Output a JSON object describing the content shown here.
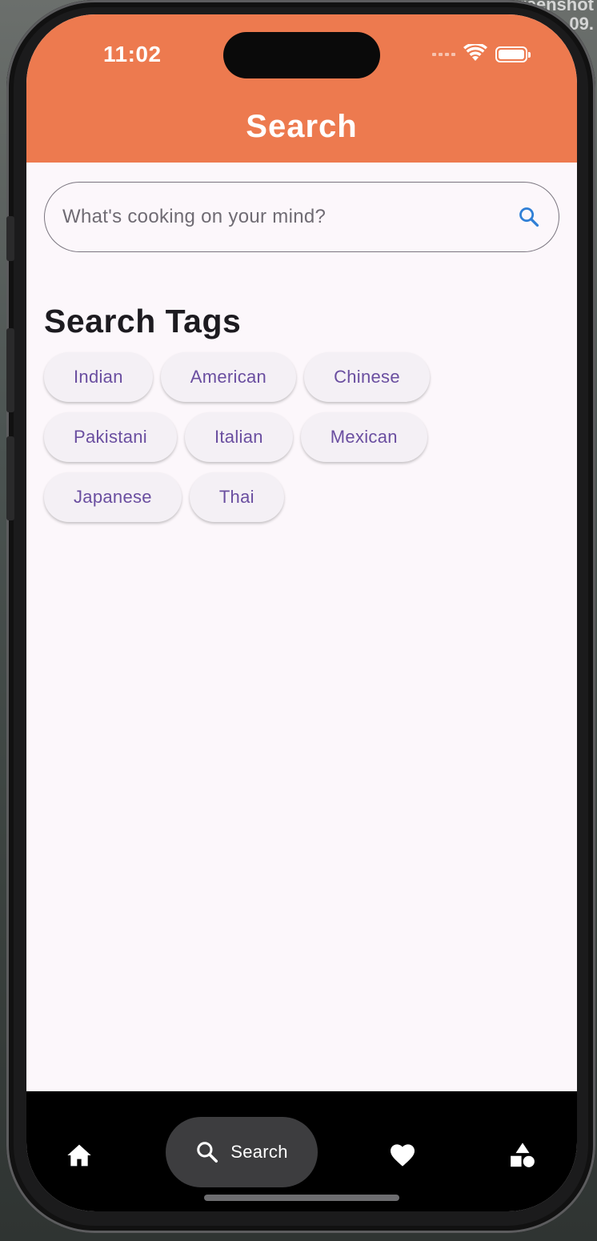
{
  "desktop": {
    "caption_line1": "Screenshot",
    "caption_line2": "09."
  },
  "status_bar": {
    "time": "11:02",
    "icons": [
      "cellular-signal-icon",
      "wifi-icon",
      "battery-icon"
    ]
  },
  "appbar": {
    "title": "Search",
    "background_color": "#ed7a4f"
  },
  "search": {
    "placeholder": "What's cooking on your mind?",
    "value": "",
    "icon": "search-icon",
    "icon_color": "#2f7fd6"
  },
  "tags_section": {
    "title": "Search Tags",
    "tags": [
      "Indian",
      "American",
      "Chinese",
      "Pakistani",
      "Italian",
      "Mexican",
      "Japanese",
      "Thai"
    ]
  },
  "bottom_nav": {
    "items": [
      {
        "name": "home",
        "icon": "home-icon",
        "label": ""
      },
      {
        "name": "search",
        "icon": "search-icon",
        "label": "Search",
        "selected": true
      },
      {
        "name": "favorites",
        "icon": "heart-icon",
        "label": ""
      },
      {
        "name": "categories",
        "icon": "shapes-icon",
        "label": ""
      }
    ]
  }
}
